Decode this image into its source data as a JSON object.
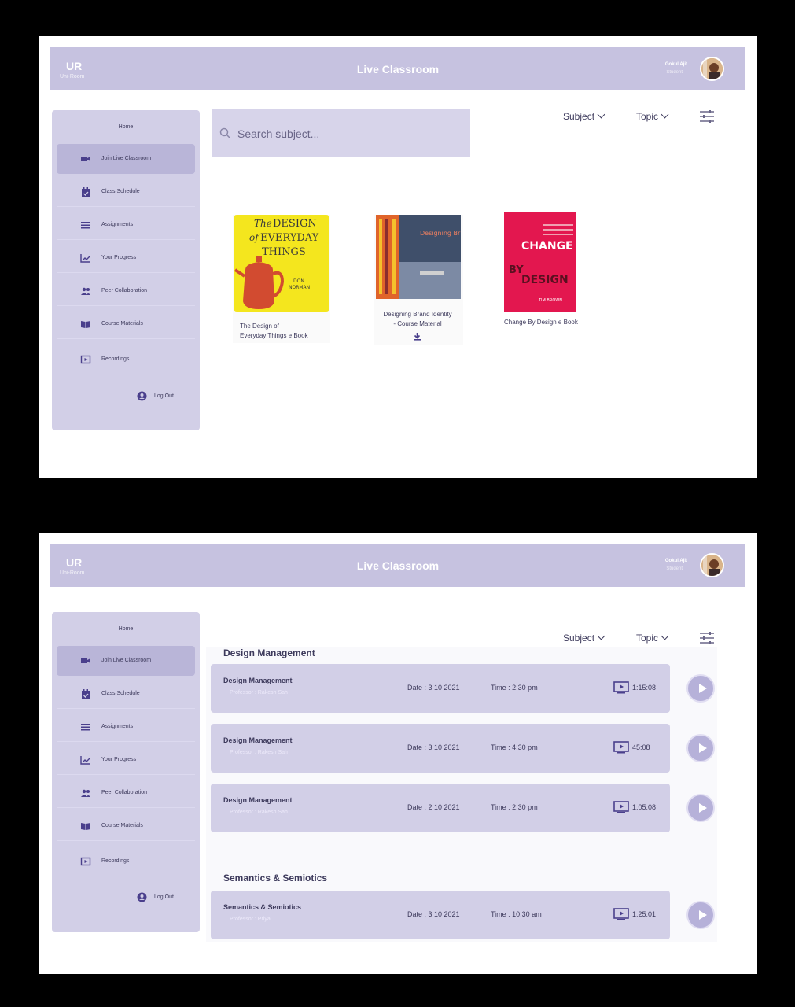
{
  "app": {
    "logo": "UR",
    "logo_subtitle": "Uni-Room",
    "title": "Live Classroom",
    "user_name": "Gokul Ajit",
    "user_role": "Student"
  },
  "sidebar": {
    "home": "Home",
    "items": [
      {
        "label": "Join Live Classroom",
        "icon": "video-camera-icon",
        "active": true
      },
      {
        "label": "Class Schedule",
        "icon": "calendar-icon"
      },
      {
        "label": "Assignments",
        "icon": "list-icon"
      },
      {
        "label": "Your Progress",
        "icon": "trending-chart-icon"
      },
      {
        "label": "Peer Collaboration",
        "icon": "people-icon"
      },
      {
        "label": "Course Materials",
        "icon": "book-icon"
      },
      {
        "label": "Recordings",
        "icon": "play-screen-icon"
      }
    ],
    "logout": "Log Out"
  },
  "search": {
    "placeholder": "Search subject..."
  },
  "filters": {
    "subject": "Subject",
    "topic": "Topic"
  },
  "books": [
    {
      "title_line1": "The Design of",
      "title_line2": "Everyday Things e Book",
      "cover_small": "The",
      "cover_line1": "DESIGN",
      "cover_of": "of",
      "cover_line2": "EVERYDAY",
      "cover_line3": "THINGS",
      "cover_author1": "DON",
      "cover_author2": "NORMAN"
    },
    {
      "title_line1": "Designing Brand Identity",
      "title_line2": "- Course Material",
      "cover_text": "Designing Brand Identity"
    },
    {
      "title_line1": "Change By Design e Book",
      "cover_line1": "CHANGE",
      "cover_line2": "BY",
      "cover_line3": "DESIGN",
      "cover_author": "TIM BROWN"
    }
  ],
  "recordings": {
    "sections": [
      {
        "title": "Design Management",
        "items": [
          {
            "title": "Design Management",
            "professor": "Professor : Rakesh Sah",
            "date": "Date : 3 10 2021",
            "time": "Time : 2:30 pm",
            "duration": "1:15:08"
          },
          {
            "title": "Design Management",
            "professor": "Professor : Rakesh Sah",
            "date": "Date : 3 10 2021",
            "time": "Time : 4:30 pm",
            "duration": "45:08"
          },
          {
            "title": "Design Management",
            "professor": "Professor : Rakesh Sah",
            "date": "Date : 2 10 2021",
            "time": "Time : 2:30 pm",
            "duration": "1:05:08"
          }
        ]
      },
      {
        "title": "Semantics & Semiotics",
        "items": [
          {
            "title": "Semantics & Semiotics",
            "professor": "Professor : Priya",
            "date": "Date : 3 10 2021",
            "time": "Time : 10:30 am",
            "duration": "1:25:01"
          }
        ]
      }
    ]
  },
  "colors": {
    "accent": "#c6c2e0",
    "sidebar": "#d2cfe7",
    "text": "#3d3a5c",
    "active": "#b9b5d8"
  }
}
